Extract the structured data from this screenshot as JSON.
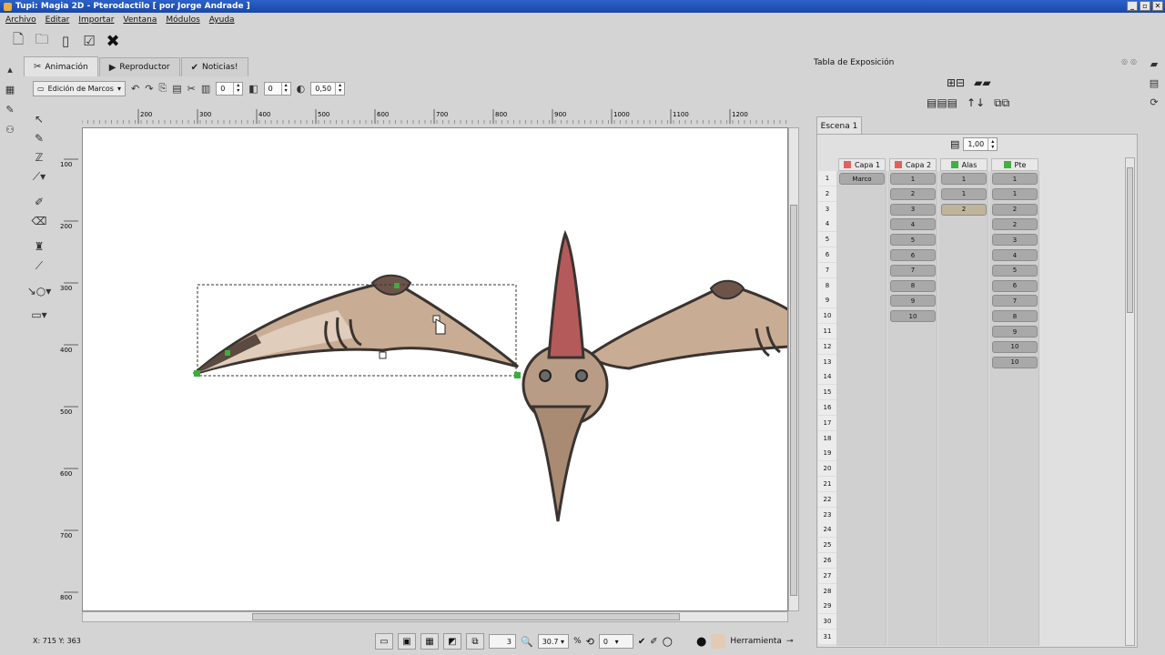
{
  "window": {
    "title": "Tupi: Magia 2D - Pterodactilo [ por Jorge Andrade ]",
    "controls": [
      "_",
      "▫",
      "✕"
    ]
  },
  "menu": [
    "Archivo",
    "Editar",
    "Importar",
    "Ventana",
    "Módulos",
    "Ayuda"
  ],
  "tabs": [
    {
      "label": "Animación",
      "icon": "animation-icon"
    },
    {
      "label": "Reproductor",
      "icon": "play-icon"
    },
    {
      "label": "Noticias!",
      "icon": "twitter-icon"
    }
  ],
  "editor_toolbar": {
    "mode": "Edición de Marcos",
    "spin1": "0",
    "spin2": "0",
    "opacity": "0,50"
  },
  "ruler": {
    "top": [
      "200",
      "300",
      "400",
      "500",
      "600",
      "700",
      "800",
      "900",
      "1000",
      "1100",
      "1200"
    ],
    "left": [
      "100",
      "200",
      "300",
      "400",
      "500",
      "600",
      "700",
      "800"
    ]
  },
  "status": {
    "coords": "X: 715 Y: 363",
    "frame": "3",
    "zoom": "30.7",
    "percent": "%",
    "rotation": "0",
    "tool_label": "Herramienta"
  },
  "exposure": {
    "title": "Tabla de Exposición",
    "scene_tab": "Escena 1",
    "speed": "1,00",
    "layers": [
      {
        "name": "Capa 1",
        "color": "#e06060"
      },
      {
        "name": "Capa 2",
        "color": "#e06060"
      },
      {
        "name": "Alas",
        "color": "#40b040"
      },
      {
        "name": "Pte",
        "color": "#40b040"
      }
    ],
    "rows": [
      "1",
      "2",
      "3",
      "4",
      "5",
      "6",
      "7",
      "8",
      "9",
      "10",
      "11",
      "12",
      "13",
      "14",
      "15",
      "16",
      "17",
      "18",
      "19",
      "20",
      "21",
      "22",
      "23",
      "24",
      "25",
      "26",
      "27",
      "28",
      "29",
      "30",
      "31"
    ],
    "frames": [
      [
        "Marco"
      ],
      [
        "1",
        "2",
        "3",
        "4",
        "5",
        "6",
        "7",
        "8",
        "9",
        "10"
      ],
      [
        "1",
        "1",
        "2"
      ],
      [
        "1",
        "1",
        "2",
        "2",
        "3",
        "4",
        "5",
        "6",
        "7",
        "8",
        "9",
        "10",
        "10"
      ]
    ]
  }
}
